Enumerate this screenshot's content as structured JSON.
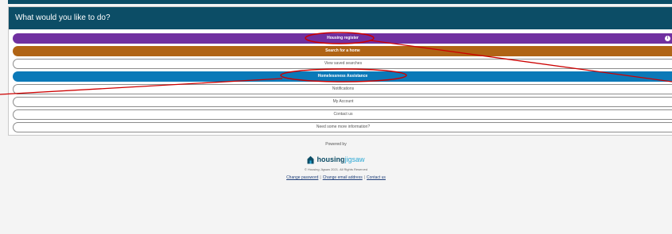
{
  "panel": {
    "title": "What would you like to do?"
  },
  "menu": {
    "items": [
      {
        "label": "Housing register",
        "style": "solid",
        "color": "#7030a0",
        "has_info": true,
        "info_symbol": "i"
      },
      {
        "label": "Search for a home",
        "style": "solid",
        "color": "#b06415"
      },
      {
        "label": "View saved searches",
        "style": "outline"
      },
      {
        "label": "Homelessness Assistance",
        "style": "solid",
        "color": "#0b79b8"
      },
      {
        "label": "Notifications",
        "style": "outline"
      },
      {
        "label": "My Account",
        "style": "outline"
      },
      {
        "label": "Contact us",
        "style": "outline"
      },
      {
        "label": "Need some more information?",
        "style": "outline"
      }
    ]
  },
  "footer": {
    "powered_by": "Powered by",
    "logo_text_main": "housing",
    "logo_text_accent": "jigsaw",
    "logo_icon": "house-icon",
    "copyright": "© Housing Jigsaw 2021. All Rights Reserved",
    "links": [
      "Change password",
      "Change email address",
      "Contact us"
    ],
    "separator": "|"
  },
  "colors": {
    "header_bg": "#0c4d66",
    "annotation_red": "#cc0000"
  }
}
